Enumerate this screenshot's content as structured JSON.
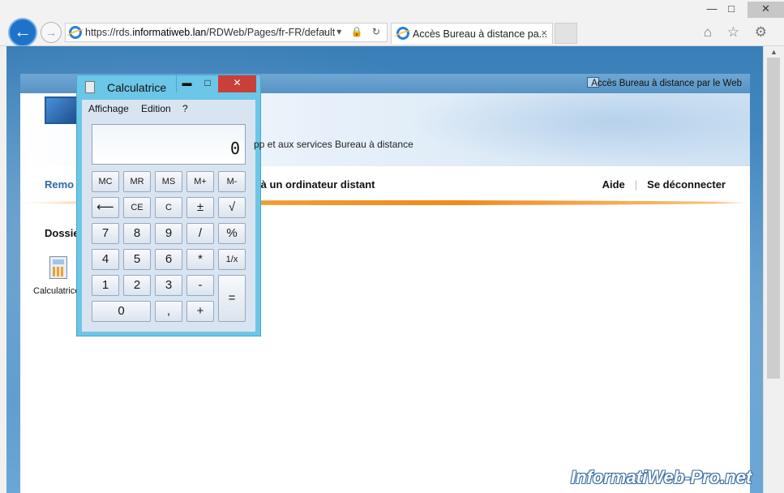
{
  "browser": {
    "url_prefix": "https://rds.",
    "url_domain": "informatiweb.lan",
    "url_path": "/RDWeb/Pages/fr-FR/default",
    "address_icons": "⌕ ▾ 🔒 ↻",
    "tab_title": "Accès Bureau à distance pa...",
    "tab_close": "×",
    "window_controls": {
      "minimize": "—",
      "maximize": "□",
      "close": "✕"
    },
    "nav_back": "←",
    "nav_forward": "→",
    "toolbar_icons": "⌂ ☆ ⚙"
  },
  "rdweb": {
    "top_label": "Accès Bureau à distance par le Web",
    "subtitle": "pp et aux services Bureau à distance",
    "nav_left": "Remo",
    "nav_mid": "r à un ordinateur distant",
    "nav_help": "Aide",
    "nav_sep": "|",
    "nav_logout": "Se déconnecter",
    "folder_title": "Dossie",
    "app_label": "Calculatrice"
  },
  "calculator": {
    "title": "Calculatrice",
    "controls": {
      "minimize": "▬",
      "maximize": "□",
      "close": "✕"
    },
    "menu": [
      "Affichage",
      "Edition",
      "?"
    ],
    "display": "0",
    "rows": [
      [
        "MC",
        "MR",
        "MS",
        "M+",
        "M-"
      ],
      [
        "⟵",
        "CE",
        "C",
        "±",
        "√"
      ],
      [
        "7",
        "8",
        "9",
        "/",
        "%"
      ],
      [
        "4",
        "5",
        "6",
        "*",
        "1/x"
      ],
      [
        "1",
        "2",
        "3",
        "-"
      ],
      [
        "0",
        ",",
        "+"
      ]
    ],
    "equals": "="
  },
  "watermark": "InformatiWeb-Pro.net"
}
